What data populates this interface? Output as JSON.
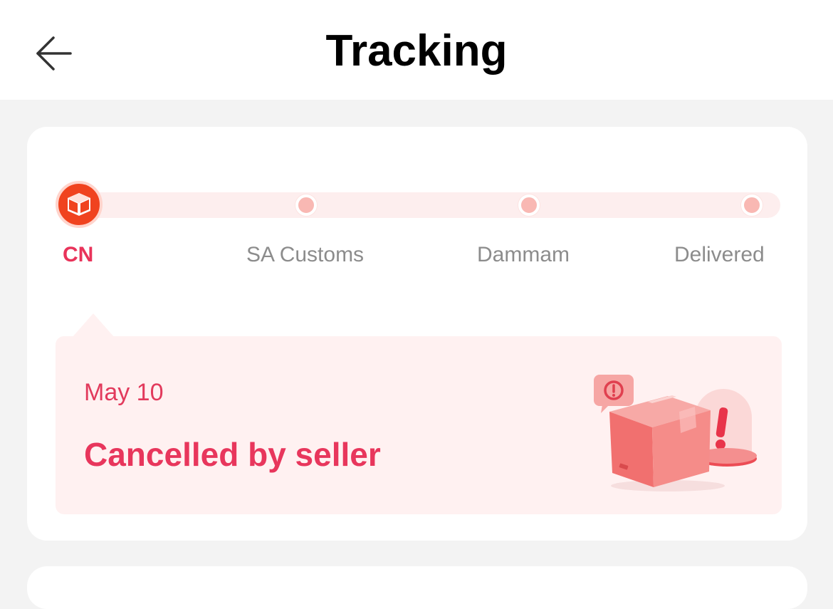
{
  "header": {
    "title": "Tracking",
    "back_icon": "arrow-left-icon"
  },
  "tracking": {
    "steps": [
      {
        "label": "CN",
        "state": "current",
        "icon": "package-box-icon"
      },
      {
        "label": "SA Customs",
        "state": "pending"
      },
      {
        "label": "Dammam",
        "state": "pending"
      },
      {
        "label": "Delivered",
        "state": "pending"
      }
    ]
  },
  "status": {
    "date": "May 10",
    "text": "Cancelled by seller",
    "illustration": "cancelled-package-illustration"
  },
  "colors": {
    "accent": "#e8365c",
    "current_node": "#f0431f",
    "track": "#fdeeee",
    "pending_dot": "#f9b8b3",
    "status_bg": "#fff1f1"
  }
}
